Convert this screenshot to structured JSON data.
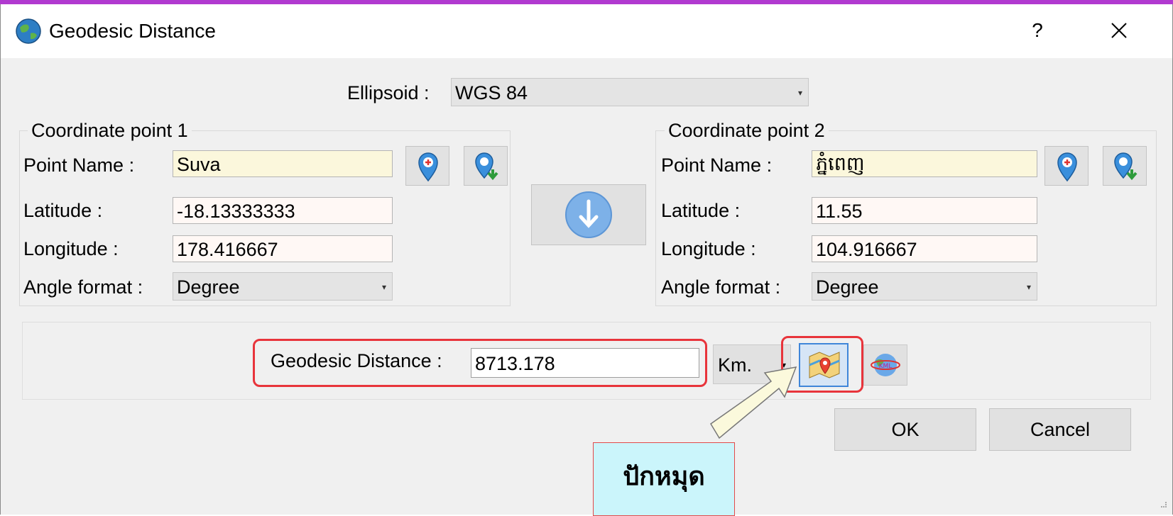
{
  "window": {
    "title": "Geodesic Distance",
    "help_label": "?"
  },
  "ellipsoid": {
    "label": "Ellipsoid :",
    "value": "WGS 84"
  },
  "point1": {
    "group_title": "Coordinate point 1",
    "name_label": "Point Name :",
    "name": "Suva",
    "lat_label": "Latitude :",
    "lat": "-18.13333333",
    "lon_label": "Longitude :",
    "lon": "178.416667",
    "angle_label": "Angle format :",
    "angle": "Degree"
  },
  "point2": {
    "group_title": "Coordinate point 2",
    "name_label": "Point Name :",
    "name": "ភ្នំពេញ",
    "lat_label": "Latitude :",
    "lat": "11.55",
    "lon_label": "Longitude :",
    "lon": "104.916667",
    "angle_label": "Angle format :",
    "angle": "Degree"
  },
  "result": {
    "label": "Geodesic Distance :",
    "value": "8713.178",
    "unit": "Km."
  },
  "buttons": {
    "ok": "OK",
    "cancel": "Cancel"
  },
  "callout": {
    "text": "ปักหมุด"
  },
  "colors": {
    "highlight": "#e8343b",
    "accent_blue": "#3f86d9",
    "callout_bg": "#cbf5fb",
    "arrow_fill": "#fbf9dc"
  }
}
